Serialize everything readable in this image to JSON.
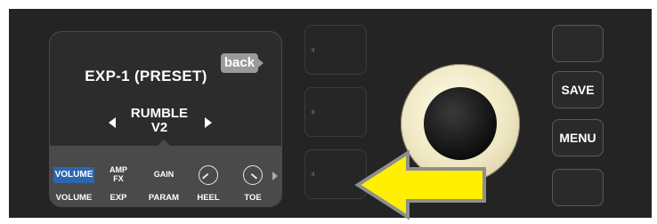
{
  "display": {
    "title": "EXP-1 (PRESET)",
    "back_label": "back",
    "preset_line1": "RUMBLE",
    "preset_line2": "V2",
    "controls": {
      "volume_box": "VOLUME",
      "amp_fx_line1": "AMP",
      "amp_fx_line2": "FX",
      "gain": "GAIN"
    },
    "labels": [
      "VOLUME",
      "EXP",
      "PARAM",
      "HEEL",
      "TOE"
    ]
  },
  "buttons": {
    "save": "SAVE",
    "menu": "MENU"
  },
  "colors": {
    "panel": "#242424",
    "selected": "#2b66b0",
    "pointer": "#ffef00",
    "knob_ring": "#efe7c2"
  }
}
